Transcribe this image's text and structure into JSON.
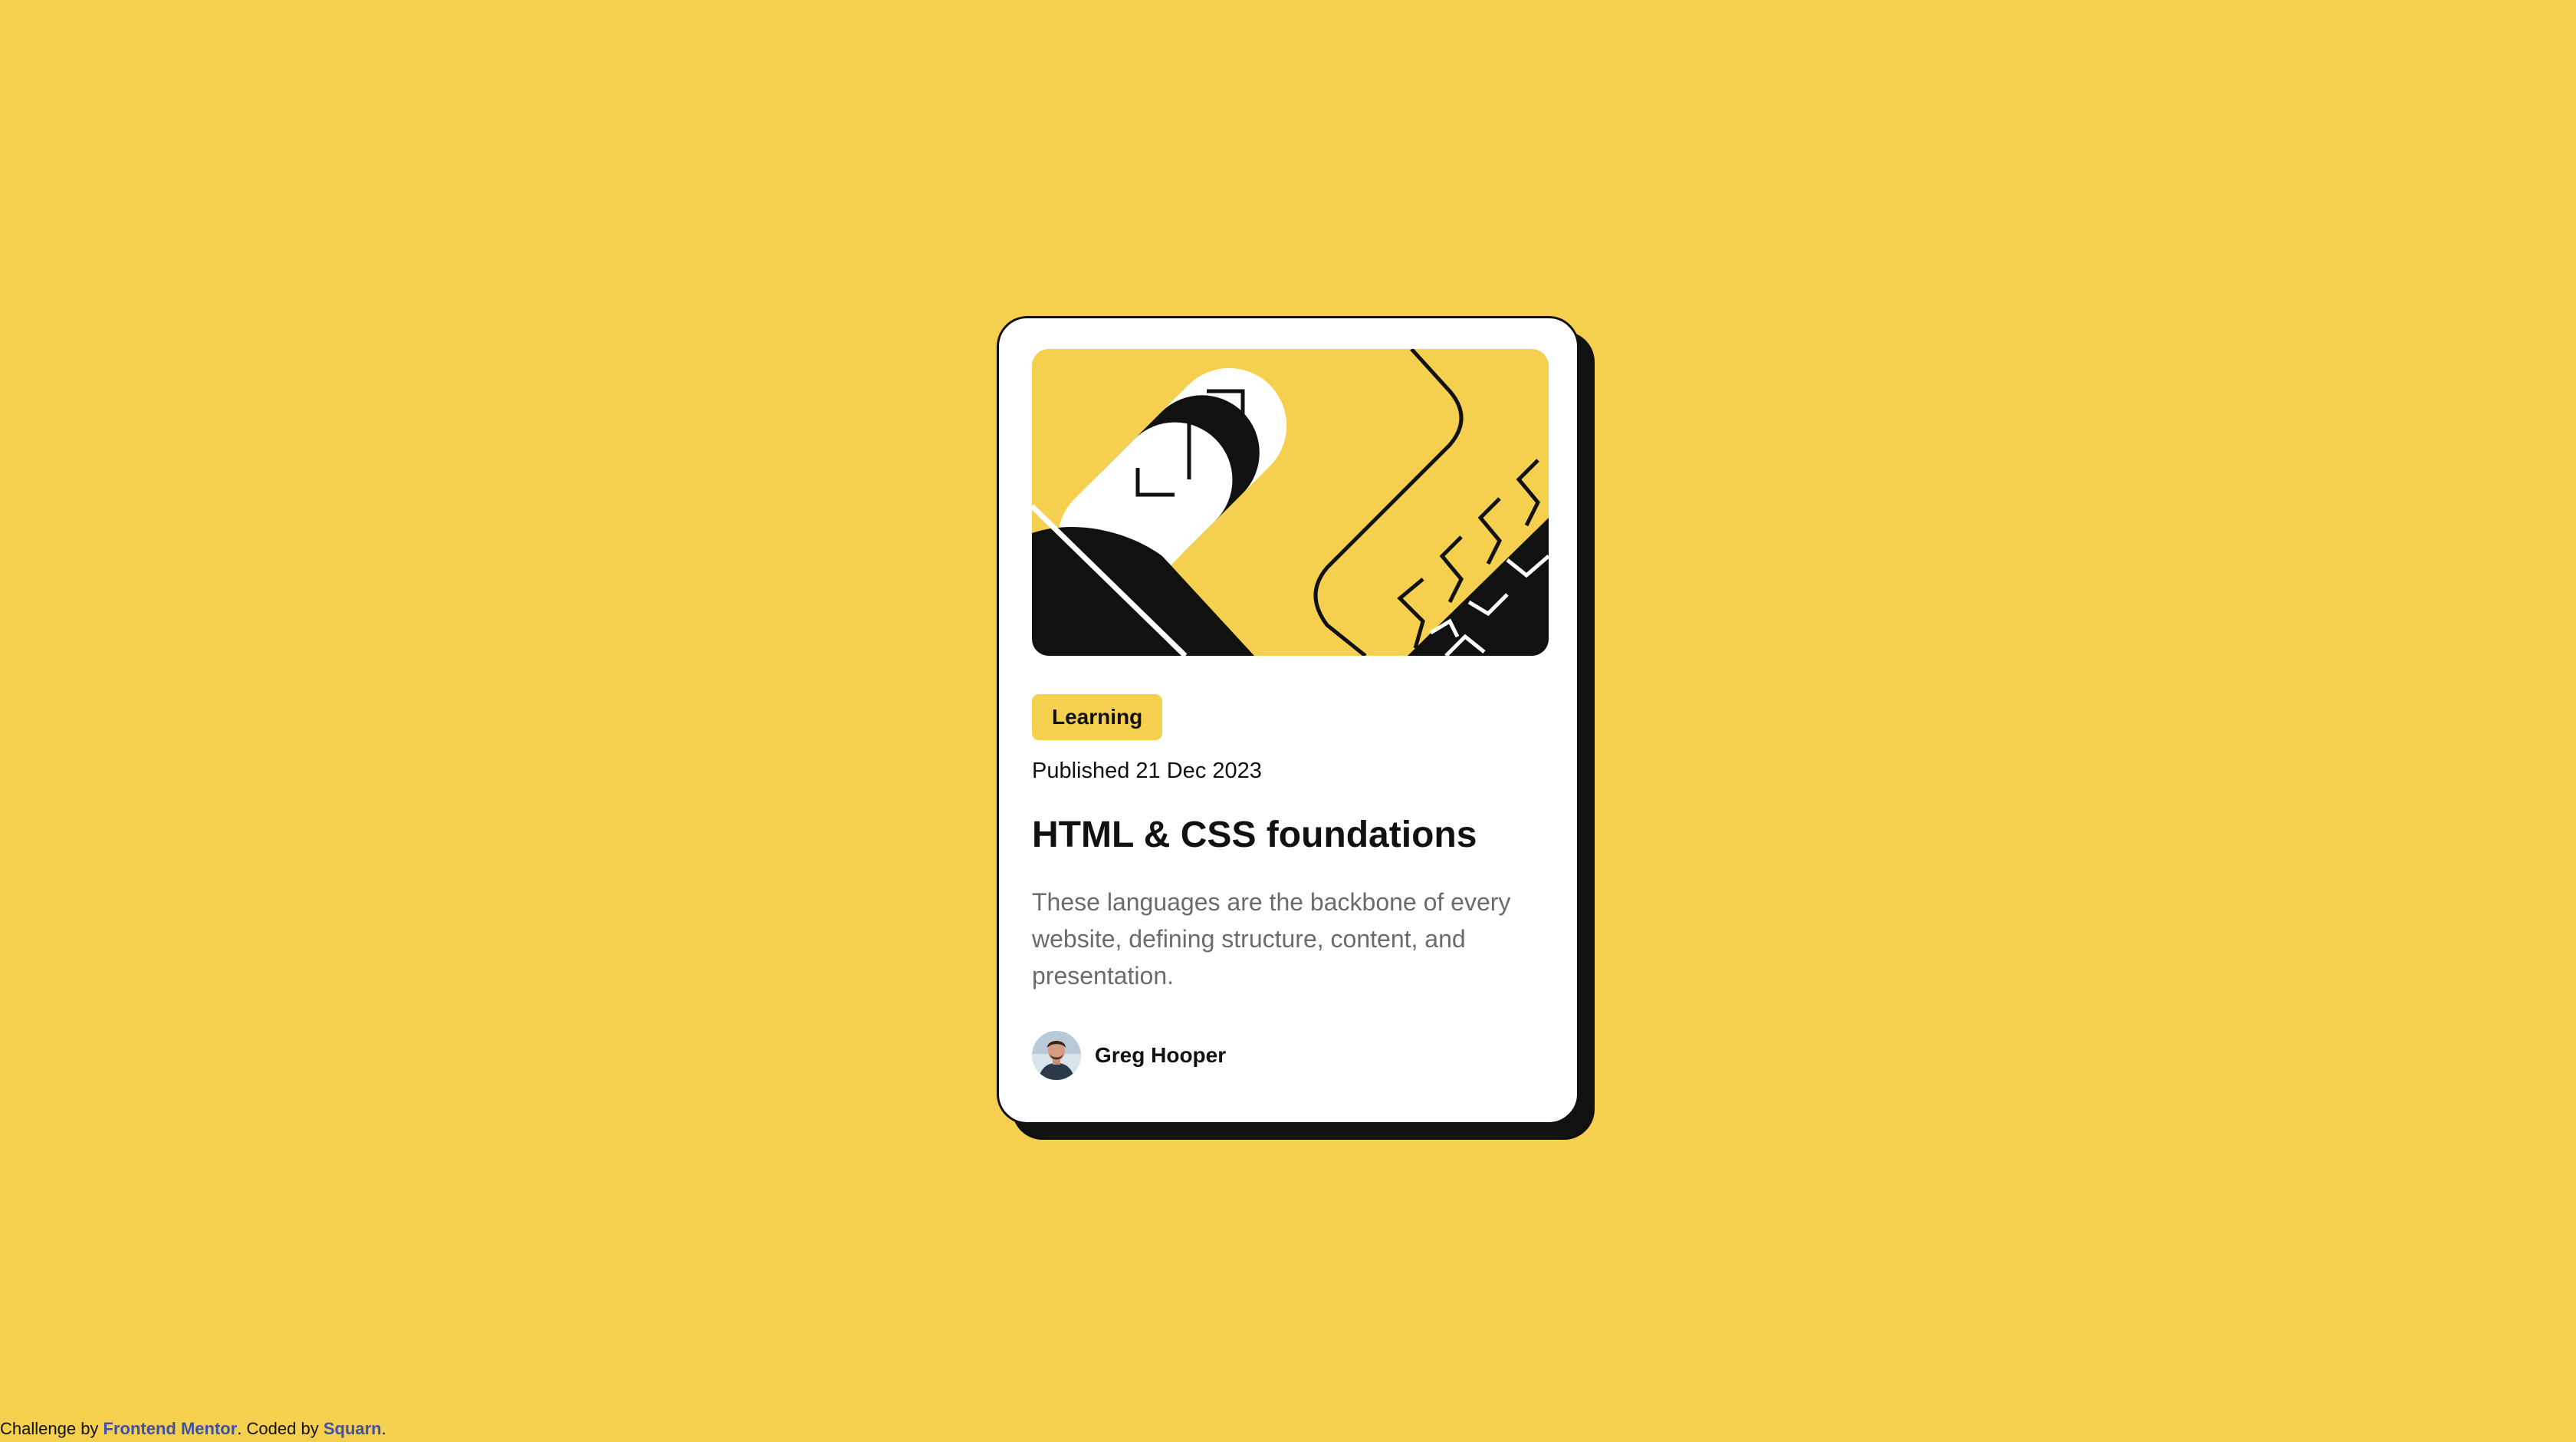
{
  "card": {
    "tag": "Learning",
    "published": "Published 21 Dec 2023",
    "title": "HTML & CSS foundations",
    "description": "These languages are the backbone of every website, defining structure, content, and presentation.",
    "author": {
      "name": "Greg Hooper",
      "avatar_icon": "avatar-photo-icon"
    },
    "illustration_icon": "abstract-illustration-icon"
  },
  "attribution": {
    "prefix": "Challenge by ",
    "link1": "Frontend Mentor",
    "middle": ". Coded by ",
    "link2": "Squarn",
    "suffix": "."
  },
  "colors": {
    "background": "#f4d04e",
    "card": "#ffffff",
    "ink": "#111111",
    "muted": "#6b6b6b",
    "link": "#3e52a3"
  }
}
